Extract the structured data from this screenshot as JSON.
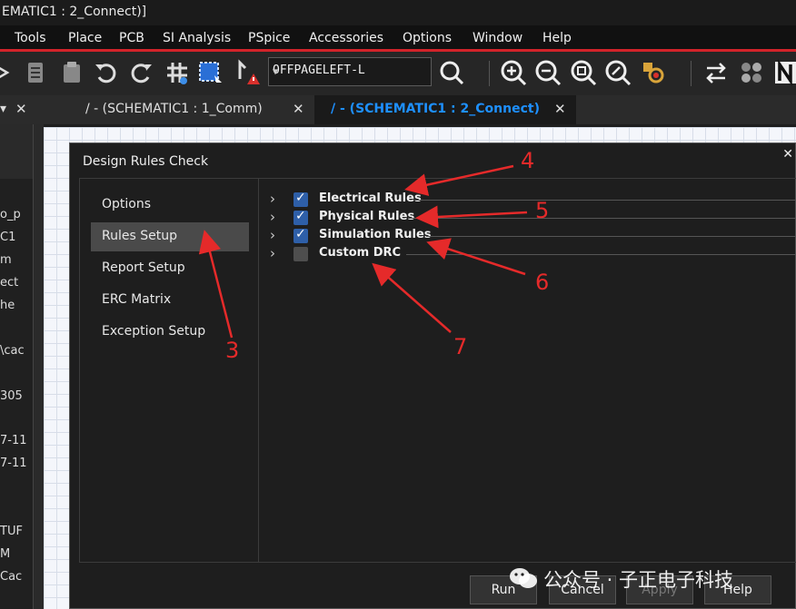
{
  "window": {
    "title": "EMATIC1 : 2_Connect)]"
  },
  "menu": [
    "Tools",
    "Place",
    "PCB",
    "SI Analysis",
    "PSpice",
    "Accessories",
    "Options",
    "Window",
    "Help"
  ],
  "toolbar": {
    "combo_value": "OFFPAGELEFT-L",
    "icons": [
      "cut-icon",
      "paste-icon",
      "clipboard-icon",
      "undo-icon",
      "redo-icon",
      "grid-icon",
      "select-area-icon",
      "drc-marker-icon",
      "zoom-icon",
      "zoom-in-icon",
      "zoom-out-icon",
      "zoom-fit-icon",
      "zoom-all-icon",
      "parts-search-icon",
      "swap-icon",
      "net-icon",
      "netlist-icon"
    ]
  },
  "tabs": [
    {
      "label": "/ - (SCHEMATIC1 : 1_Comm)",
      "active": false
    },
    {
      "label": "/ - (SCHEMATIC1 : 2_Connect)",
      "active": true
    }
  ],
  "left_panel_fragments": [
    "o_p",
    "C1",
    "m",
    "ect",
    "he",
    "\\cac",
    "305",
    "7-11",
    "7-11",
    "TUF",
    "M",
    "Cac"
  ],
  "dialog": {
    "title": "Design Rules Check",
    "nav": [
      {
        "label": "Options",
        "selected": false
      },
      {
        "label": "Rules Setup",
        "selected": true
      },
      {
        "label": "Report Setup",
        "selected": false
      },
      {
        "label": "ERC Matrix",
        "selected": false
      },
      {
        "label": "Exception Setup",
        "selected": false
      }
    ],
    "rules": [
      {
        "label": "Electrical Rules",
        "checked": true
      },
      {
        "label": "Physical Rules",
        "checked": true
      },
      {
        "label": "Simulation Rules",
        "checked": true
      },
      {
        "label": "Custom DRC",
        "checked": false
      }
    ],
    "buttons": {
      "run": "Run",
      "cancel": "Cancel",
      "apply": "Apply",
      "help": "Help"
    }
  },
  "annotations": [
    "3",
    "4",
    "5",
    "6",
    "7"
  ],
  "watermark": "公众号 · 子正电子科技",
  "colors": {
    "accent_tab": "#1e90ff",
    "menu_line": "#d2232a",
    "annotation": "#e52a2a",
    "checkbox": "#2e5fa8"
  }
}
